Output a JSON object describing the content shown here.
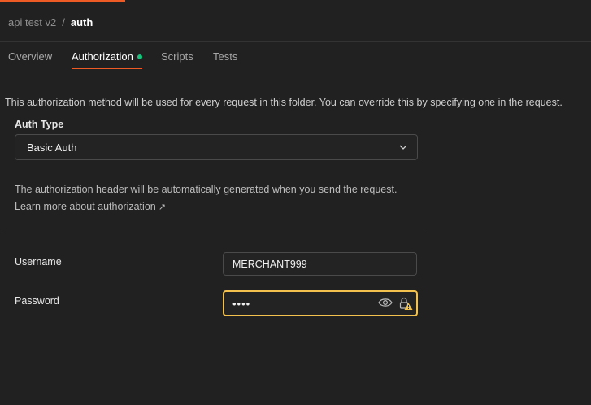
{
  "breadcrumb": {
    "parent": "api test v2",
    "separator": "/",
    "current": "auth"
  },
  "tabs": [
    {
      "label": "Overview",
      "active": false
    },
    {
      "label": "Authorization",
      "active": true,
      "indicator": "green-dot"
    },
    {
      "label": "Scripts",
      "active": false
    },
    {
      "label": "Tests",
      "active": false
    }
  ],
  "folder_info": "This authorization method will be used for every request in this folder. You can override this by specifying one in the request.",
  "auth_type": {
    "label": "Auth Type",
    "value": "Basic Auth"
  },
  "auth_description": {
    "line1": "The authorization header will be automatically generated when you send the request.",
    "learn_more_prefix": "Learn more about ",
    "link_text": "authorization",
    "link_arrow": "↗"
  },
  "fields": {
    "username": {
      "label": "Username",
      "value": "MERCHANT999"
    },
    "password": {
      "label": "Password",
      "value": "••••"
    }
  },
  "colors": {
    "background": "#212121",
    "accent": "#ef5b25",
    "status_dot": "#19c37d",
    "warning": "#f2c14e"
  }
}
